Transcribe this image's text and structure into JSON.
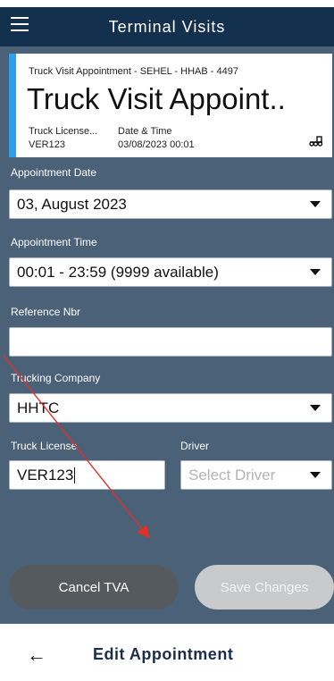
{
  "header": {
    "title": "Terminal Visits",
    "menu_icon": "hamburger-menu-icon"
  },
  "card": {
    "subtitle": "Truck Visit Appointment - SEHEL - HHAB - 4497",
    "title": "Truck Visit Appoint..",
    "col1_label": "Truck License...",
    "col1_value": "VER123",
    "col2_label": "Date & Time",
    "col2_value": "03/08/2023 00:01",
    "icon": "truck-icon",
    "accent_color": "#2f9fe6"
  },
  "form": {
    "appointment_date": {
      "label": "Appointment Date",
      "value": "03, August 2023"
    },
    "appointment_time": {
      "label": "Appointment Time",
      "value": "00:01 - 23:59 (9999 available)"
    },
    "reference_nbr": {
      "label": "Reference Nbr",
      "value": ""
    },
    "trucking_company": {
      "label": "Trucking Company",
      "value": "HHTC"
    },
    "truck_license": {
      "label": "Truck License",
      "value": "VER123"
    },
    "driver": {
      "label": "Driver",
      "placeholder": "Select Driver"
    }
  },
  "buttons": {
    "cancel": "Cancel TVA",
    "save": "Save Changes"
  },
  "bottom": {
    "title": "Edit Appointment",
    "back_icon": "back-arrow-icon"
  },
  "colors": {
    "header_bg": "#13314f",
    "content_bg": "#4a6178",
    "annotation": "#e0302a"
  }
}
